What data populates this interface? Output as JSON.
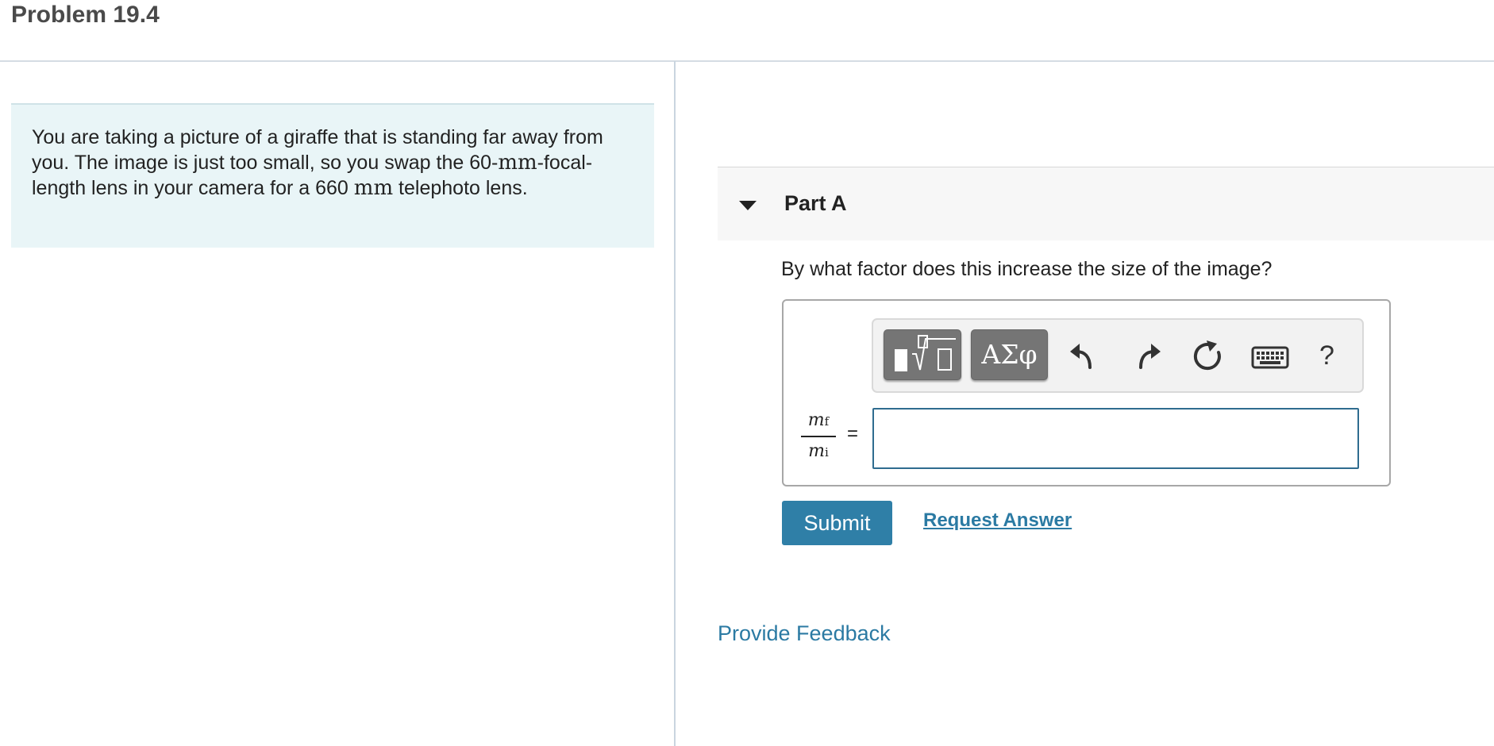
{
  "page": {
    "title": "Problem 19.4"
  },
  "problem": {
    "text_1": "You are taking a picture of a giraffe that is standing far away from you. The image is just too small, so you swap the ",
    "num_1": "60-",
    "unit_1": "mm",
    "text_2": "-focal-length lens in your camera for a 660 ",
    "unit_2": "mm",
    "text_3": " telephoto lens."
  },
  "part": {
    "title": "Part A",
    "caret_icon": "caret-down-icon"
  },
  "question": {
    "text": "By what factor does this increase the size of the image?"
  },
  "toolbar": {
    "templates_icon": "templates-icon",
    "greek_label": "ΑΣφ",
    "undo_icon": "undo-icon",
    "redo_icon": "redo-icon",
    "reset_icon": "reset-icon",
    "keyboard_icon": "keyboard-icon",
    "help_label": "?"
  },
  "answer": {
    "label_num": "m",
    "label_num_sub": "f",
    "label_den": "m",
    "label_den_sub": "i",
    "equals": "=",
    "value": ""
  },
  "actions": {
    "submit_label": "Submit",
    "request_answer_label": "Request Answer"
  },
  "footer": {
    "feedback_label": "Provide Feedback"
  },
  "colors": {
    "accent": "#2f7fa7",
    "problem_bg": "#e9f5f7",
    "toolbar_button": "#757575"
  }
}
